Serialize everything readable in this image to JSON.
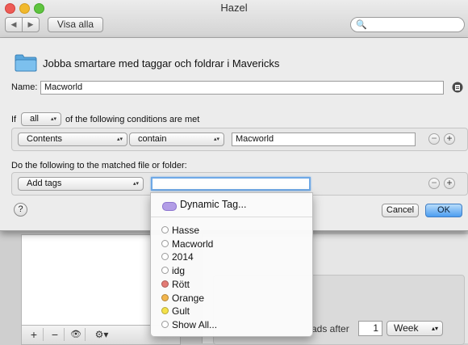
{
  "window": {
    "title": "Hazel"
  },
  "toolbar": {
    "back_label": "◀",
    "forward_label": "▶",
    "show_all_label": "Visa alla",
    "search_icon": "🔍"
  },
  "rule": {
    "title": "Jobba smartare med taggar och foldrar i Mavericks",
    "name_label": "Name:",
    "name_value": "Macworld",
    "if_label": "If",
    "match_value": "all",
    "conditions_text": "of the following conditions are met",
    "condition": {
      "attribute": "Contents",
      "operator": "contain",
      "value": "Macworld"
    },
    "actions_label": "Do the following to the matched file or folder:",
    "action": {
      "type": "Add tags",
      "value": ""
    },
    "help_label": "?",
    "cancel_label": "Cancel",
    "ok_label": "OK"
  },
  "menu": {
    "dynamic_label": "Dynamic Tag...",
    "dynamic_color": "#b29de6",
    "items": [
      {
        "label": "Hasse",
        "color": "#ffffff"
      },
      {
        "label": "Macworld",
        "color": "#ffffff"
      },
      {
        "label": "2014",
        "color": "#ffffff"
      },
      {
        "label": "idg",
        "color": "#ffffff"
      },
      {
        "label": "Rött",
        "color": "#e37a74"
      },
      {
        "label": "Orange",
        "color": "#f2b54c"
      },
      {
        "label": "Gult",
        "color": "#f4e14a"
      },
      {
        "label": "Show All...",
        "color": "#ffffff"
      }
    ]
  },
  "background": {
    "list_buttons": [
      "+",
      "−",
      "👁",
      "⚙▾"
    ],
    "frequency_text": "ads after",
    "frequency_value": "1",
    "frequency_unit": "Week"
  }
}
